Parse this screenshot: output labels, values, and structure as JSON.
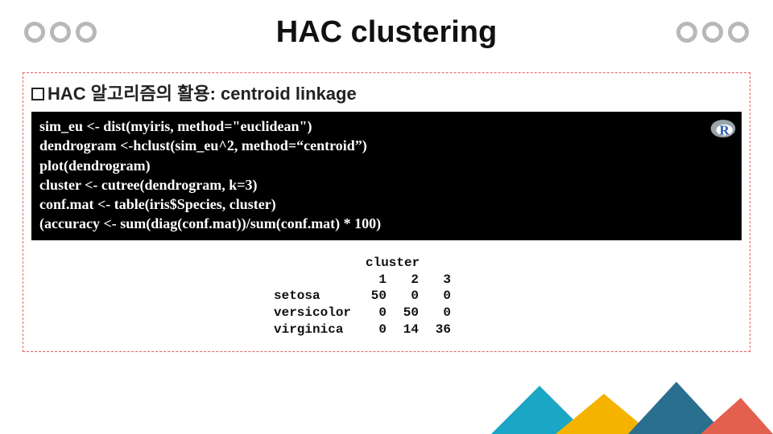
{
  "title": "HAC clustering",
  "subtitle_prefix": "HAC",
  "subtitle_rest": " 알고리즘의 활용: centroid linkage",
  "code_lines": [
    "sim_eu <- dist(myiris, method=\"euclidean\")",
    "dendrogram <-hclust(sim_eu^2, method=“centroid”)",
    "plot(dendrogram)",
    "cluster <- cutree(dendrogram, k=3)",
    "conf.mat <- table(iris$Species, cluster)",
    "(accuracy <- sum(diag(conf.mat))/sum(conf.mat) * 100)"
  ],
  "output": {
    "header": "cluster",
    "col_headers": [
      "1",
      "2",
      "3"
    ],
    "rows": [
      {
        "label": "setosa",
        "vals": [
          "50",
          "0",
          "0"
        ]
      },
      {
        "label": "versicolor",
        "vals": [
          "0",
          "50",
          "0"
        ]
      },
      {
        "label": "virginica",
        "vals": [
          "0",
          "14",
          "36"
        ]
      }
    ]
  },
  "icons": {
    "r_badge": "R"
  }
}
